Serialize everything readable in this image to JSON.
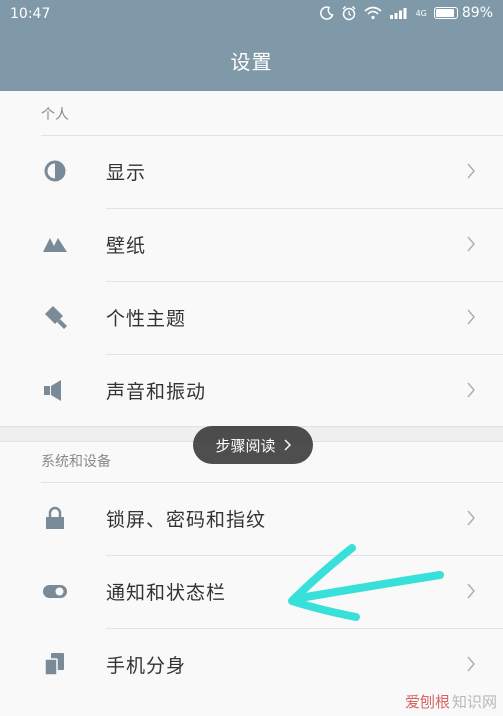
{
  "status_bar": {
    "time": "10:47",
    "battery_percent": "89%",
    "battery_level": 0.89,
    "network_label": "4G",
    "icons": [
      "moon-icon",
      "alarm-icon",
      "wifi-icon",
      "signal-icon",
      "battery-icon"
    ]
  },
  "header": {
    "title": "设置"
  },
  "sections": [
    {
      "label": "个人",
      "items": [
        {
          "label": "显示",
          "icon": "display-icon"
        },
        {
          "label": "壁纸",
          "icon": "wallpaper-icon"
        },
        {
          "label": "个性主题",
          "icon": "theme-icon"
        },
        {
          "label": "声音和振动",
          "icon": "speaker-icon"
        }
      ]
    },
    {
      "label": "系统和设备",
      "items": [
        {
          "label": "锁屏、密码和指纹",
          "icon": "lock-icon"
        },
        {
          "label": "通知和状态栏",
          "icon": "toggle-icon"
        },
        {
          "label": "手机分身",
          "icon": "phone-clone-icon"
        }
      ]
    }
  ],
  "toast": {
    "label": "步骤阅读"
  },
  "watermark": {
    "text_red": "爱刨根",
    "text_gray": "知识网"
  },
  "colors": {
    "header": "#7f99a9",
    "icon": "#7a8a96",
    "arrow": "#37e0d8"
  }
}
